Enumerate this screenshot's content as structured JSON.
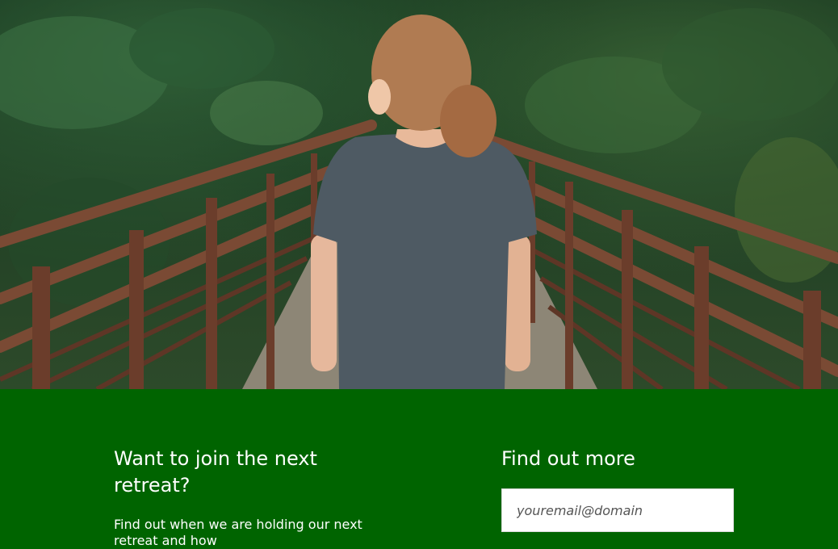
{
  "hero": {
    "image_alt": "Woman walking across a wooden footbridge in a forest"
  },
  "signup": {
    "heading": "Want to join the next retreat?",
    "description": "Find out when we are holding our next retreat and how",
    "form_heading": "Find out more",
    "email_placeholder": "youremail@domain"
  },
  "colors": {
    "section_background": "#006400",
    "heading_text": "#ffffff",
    "input_background": "#ffffff"
  }
}
